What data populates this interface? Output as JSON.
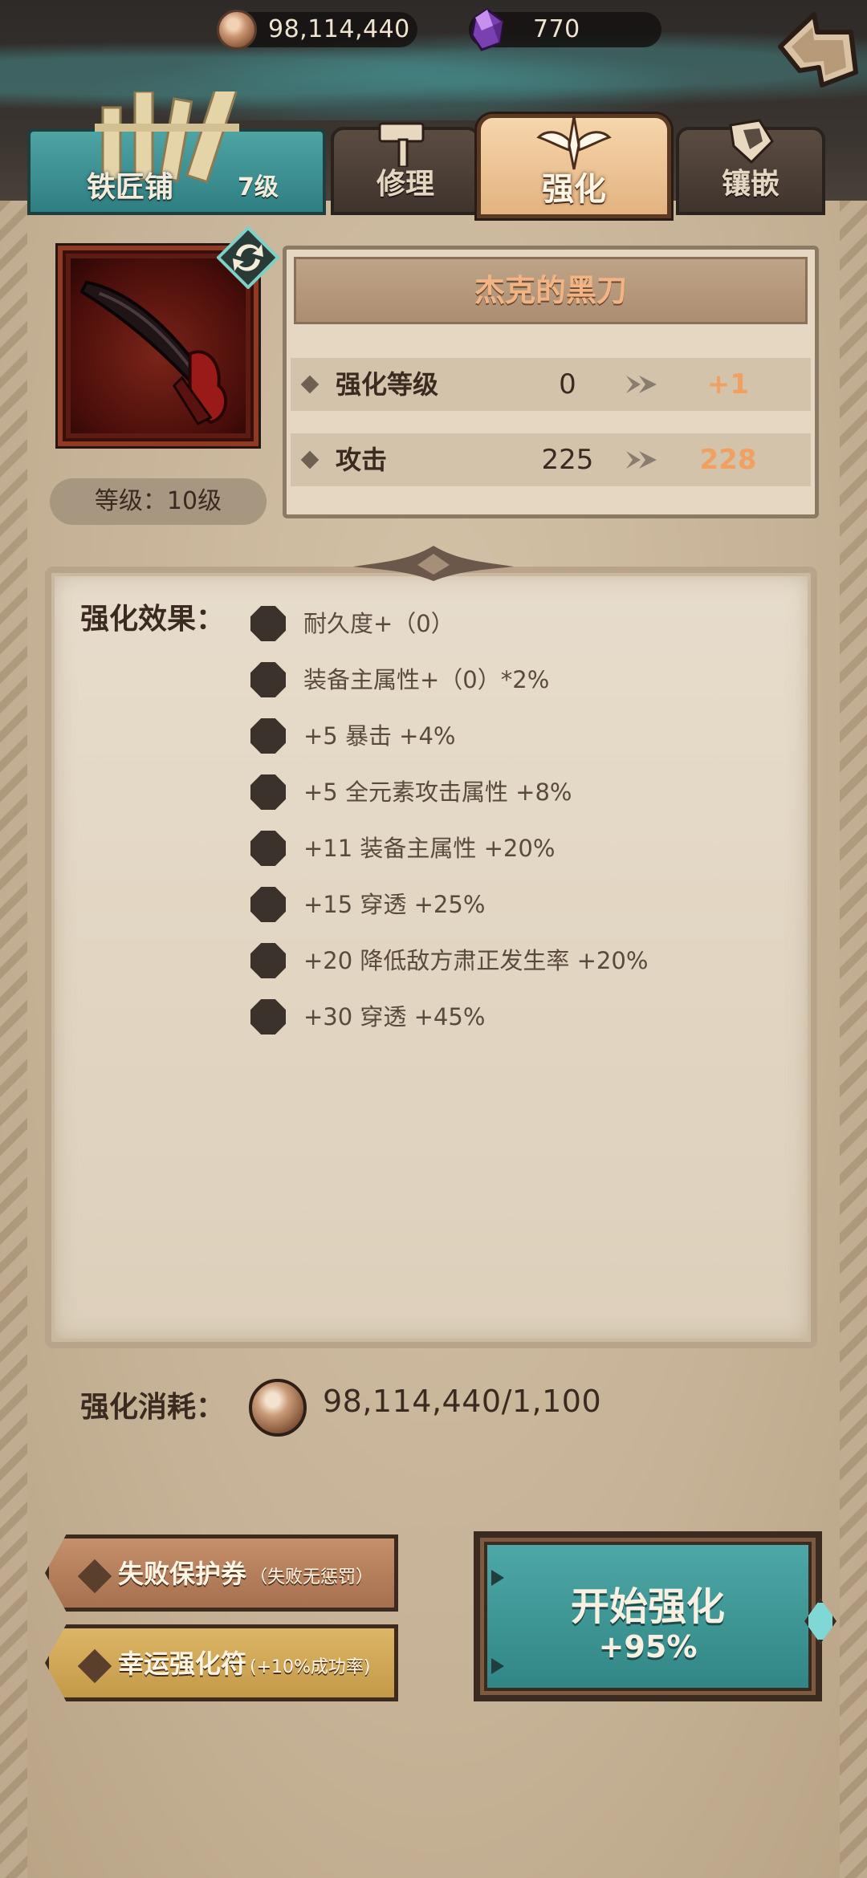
{
  "currency": {
    "coins": "98,114,440",
    "gems": "770"
  },
  "tabs": {
    "smithy_label": "铁匠铺",
    "smithy_level": "7级",
    "repair": "修理",
    "enhance": "强化",
    "inlay": "镶嵌"
  },
  "item": {
    "name": "杰克的黑刀",
    "level_text": "等级：10级",
    "stats": [
      {
        "label": "强化等级",
        "current": "0",
        "next": "+1"
      },
      {
        "label": "攻击",
        "current": "225",
        "next": "228"
      }
    ]
  },
  "effects": {
    "title": "强化效果：",
    "list": [
      "耐久度+（0）",
      "装备主属性+（0）*2%",
      "+5  暴击 +4%",
      "+5  全元素攻击属性 +8%",
      "+11  装备主属性 +20%",
      "+15  穿透 +25%",
      "+20  降低敌方肃正发生率 +20%",
      "+30  穿透 +45%"
    ]
  },
  "cost": {
    "label": "强化消耗：",
    "value": "98,114,440/1,100"
  },
  "buttons": {
    "fail_protect_main": "失败保护券",
    "fail_protect_sub": "（失败无惩罚）",
    "lucky_main": "幸运强化符",
    "lucky_sub": "(+10%成功率)",
    "start_main": "开始强化",
    "start_rate": "+95%"
  },
  "colors": {
    "accent_orange": "#f0a060",
    "teal": "#3f9796",
    "panel": "#e5d7c1",
    "dark_frame": "#3a2a1f"
  }
}
